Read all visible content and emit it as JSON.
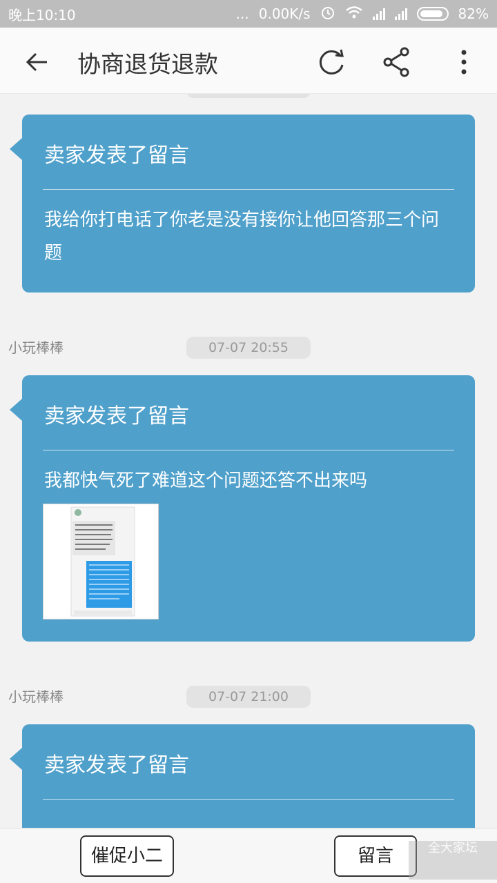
{
  "status_bar": {
    "time": "晚上10:10",
    "dots": "...",
    "speed": "0.00K/s",
    "battery": "82%"
  },
  "app_bar": {
    "title": "协商退货退款",
    "icons": [
      "back-arrow-icon",
      "refresh-icon",
      "share-icon",
      "more-icon"
    ]
  },
  "messages": [
    {
      "title": "卖家发表了留言",
      "text": "我给你打电话了你老是没有接你让他回答那三个问题"
    },
    {
      "user": "小玩棒棒",
      "time": "07-07 20:55",
      "title": "卖家发表了留言",
      "text": "我都快气死了难道这个问题还答不出来吗",
      "has_image": true
    },
    {
      "user": "小玩棒棒",
      "time": "07-07 21:00",
      "title": "卖家发表了留言"
    }
  ],
  "bottom_bar": {
    "remind_label": "催促小二",
    "comment_label": "留言",
    "watermark": "全大家坛"
  },
  "colors": {
    "card": "#4fa0cb",
    "status_bar": "#bdbdbd",
    "app_bar": "#fafafa"
  }
}
